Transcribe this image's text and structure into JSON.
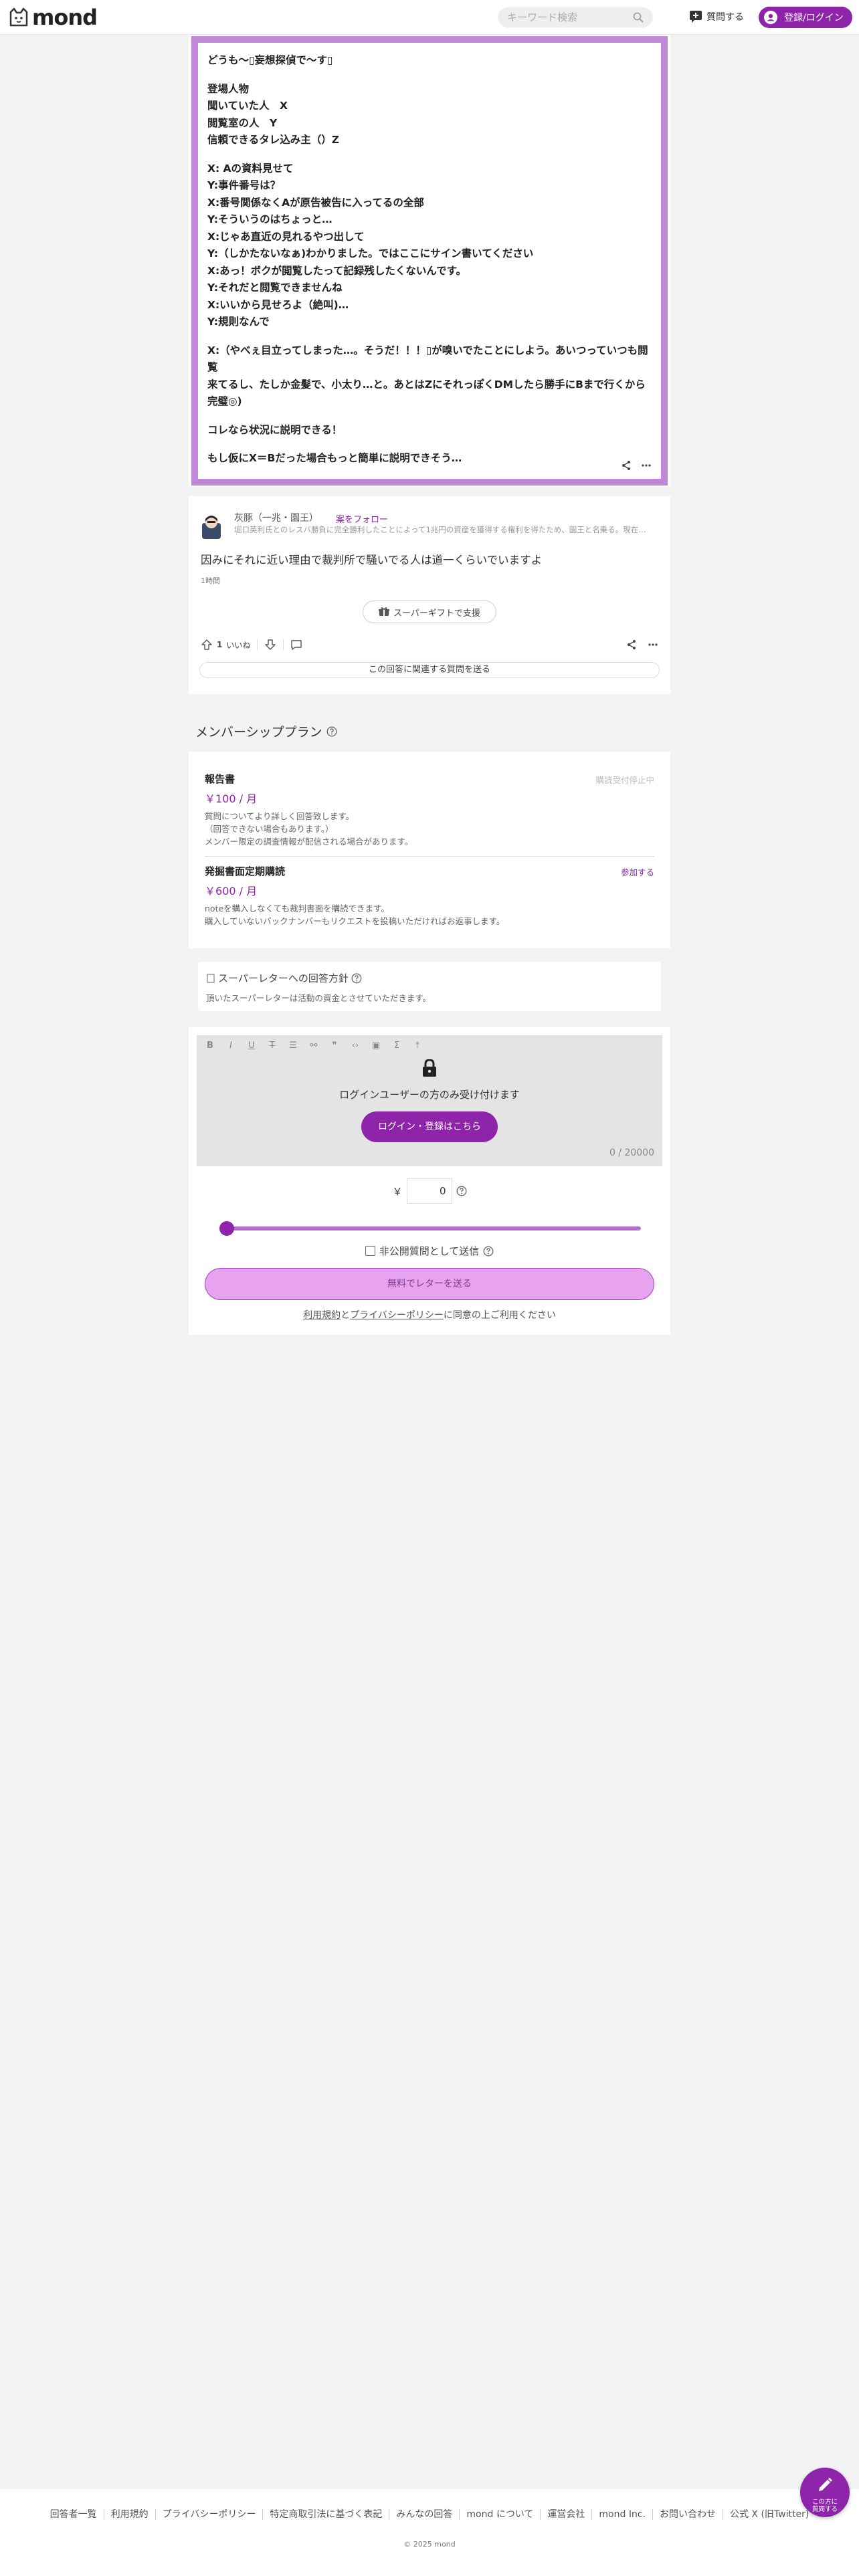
{
  "header": {
    "logo_text": "mond",
    "search_placeholder": "キーワード検索",
    "ask_label": "質問する",
    "login_label": "登録/ログイン"
  },
  "answer": {
    "paragraphs": [
      [
        "どうも〜▯妄想探偵で〜す▯"
      ],
      [
        "登場人物",
        "聞いていた人　X",
        "閲覧室の人　Y",
        "信頼できるタレ込み主（）Z"
      ],
      [
        "X: Aの資料見せて",
        "Y:事件番号は？",
        "X:番号関係なくAが原告被告に入ってるの全部",
        "Y:そういうのはちょっと…",
        "X:じゃあ直近の見れるやつ出して",
        "Y:（しかたないなぁ)わかりました。ではここにサイン書いてください",
        "X:あっ！ボクが閲覧したって記録残したくないんです。",
        "Y:それだと閲覧できませんね",
        "X:いいから見せろよ（絶叫)…",
        "Y:規則なんで"
      ],
      [
        "X:（やべぇ目立ってしまった…。そうだ！！！▯が嗅いでたことにしよう。あいつっていつも閲覧",
        "来てるし、たしか金髪で、小太り…と。あとはZにそれっぽくDMしたら勝手にBまで行くから",
        "完璧◎)"
      ],
      [
        "コレなら状況に説明できる！"
      ],
      [
        "もし仮にX＝Bだった場合もっと簡単に説明できそう…"
      ]
    ]
  },
  "comment": {
    "name": "灰豚（一兆・園王）",
    "follow_label": "案をフォロー",
    "bio": "堀口英利氏とのレスバ勝負に完全勝利したことによって1兆円の資産を獲得する権利を得たため、園王と名乗る。現在…",
    "text": "因みにそれに近い理由で裁判所で騒いでる人は道一くらいでいますよ",
    "time": "1時間",
    "gift_label": "スーパーギフトで支援",
    "like_count": "1",
    "like_label": "いいね",
    "related_label": "この回答に関連する質問を送る"
  },
  "membership": {
    "heading": "メンバーシッププラン",
    "plans": [
      {
        "title": "報告書",
        "price": "￥100 / 月",
        "status": "購読受付停止中",
        "desc": [
          "質問についてより詳しく回答致します。",
          "（回答できない場合もあります。）",
          "メンバー限定の調査情報が配信される場合があります。"
        ]
      },
      {
        "title": "発掘書面定期購読",
        "price": "￥600 / 月",
        "status": "参加する",
        "desc": [
          "noteを購入しなくても裁判書面を購読できます。",
          "購入していないバックナンバーもリクエストを投稿いただければお返事します。"
        ]
      }
    ]
  },
  "policy": {
    "title": "スーパーレターへの回答方針",
    "text": "頂いたスーパーレターは活動の資金とさせていただきます。"
  },
  "letter": {
    "login_message": "ログインユーザーの方のみ受け付けます",
    "login_button": "ログイン・登録はこちら",
    "char_count": "0 / 20000",
    "currency": "￥",
    "amount": "0",
    "slider_level": 0,
    "private_label": "非公開質問として送信",
    "send_label": "無料でレターを送る",
    "agree_terms": "利用規約",
    "agree_and": "と",
    "agree_privacy": "プライバシーポリシー",
    "agree_suffix": "に同意の上ご利用ください"
  },
  "footer": {
    "links": [
      "回答者一覧",
      "利用規約",
      "プライバシーポリシー",
      "特定商取引法に基づく表記",
      "みんなの回答",
      "mond について",
      "運営会社",
      "mond Inc.",
      "お問い合わせ",
      "公式 X (旧Twitter)"
    ],
    "copyright": "© 2025 mond"
  },
  "fab": {
    "label_1": "この方に",
    "label_2": "質問する"
  },
  "colors": {
    "accent": "#8e24aa",
    "frame": "#c287d8",
    "send_button": "#e7a3ef"
  }
}
